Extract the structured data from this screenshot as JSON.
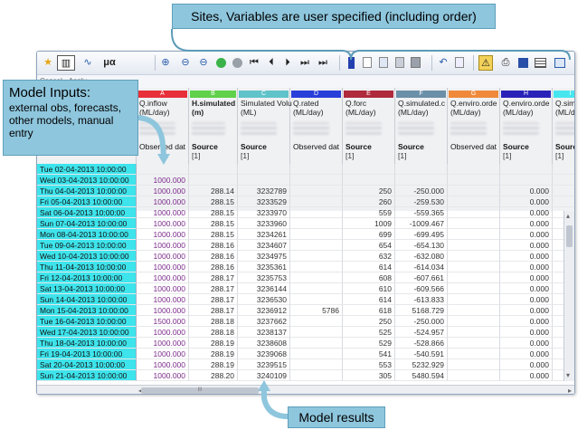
{
  "callouts": {
    "top": "Sites, Variables are user specified (including order)",
    "left_title": "Model Inputs:",
    "left_body": "external obs, forecasts, other models, manual entry",
    "bottom": "Model results"
  },
  "toolbar": {
    "sub_labels": [
      "Cancel",
      "Apply"
    ],
    "glyphs": {
      "star": "★",
      "table": "▥",
      "line": "∿",
      "mu": "μα",
      "zoom": "⊕",
      "zoomout": "⊖",
      "first": "⏮",
      "prev": "⏴",
      "next": "⏵",
      "last": "⏭",
      "undo": "↶",
      "warn": "⚠",
      "print": "⎙",
      "save": "💾"
    }
  },
  "columns": [
    {
      "letter": "A",
      "color": "#e8303a",
      "title": "Q.inflow\n(ML/day)",
      "bold": false,
      "source": "Observed dat",
      "source_sub": ""
    },
    {
      "letter": "B",
      "color": "#5fd14a",
      "title": "H.simulated\n(m)",
      "bold": true,
      "source": "Source",
      "source_sub": "[1]"
    },
    {
      "letter": "C",
      "color": "#5fc3c9",
      "title": "Simulated Volu\n(ML)",
      "bold": false,
      "source": "Source",
      "source_sub": "[1]"
    },
    {
      "letter": "D",
      "color": "#2a3fd9",
      "title": "Q.rated\n(ML/day)",
      "bold": false,
      "source": "Observed dat",
      "source_sub": ""
    },
    {
      "letter": "E",
      "color": "#b02a3d",
      "title": "Q.forc\n(ML/day)",
      "bold": false,
      "source": "Source",
      "source_sub": "[1]"
    },
    {
      "letter": "F",
      "color": "#6a8fa8",
      "title": "Q.simulated.c\n(ML/day)",
      "bold": false,
      "source": "Source",
      "source_sub": "[1]"
    },
    {
      "letter": "G",
      "color": "#f08a3a",
      "title": "Q.enviro.orde\n(ML/day)",
      "bold": false,
      "source": "Observed dat",
      "source_sub": ""
    },
    {
      "letter": "H",
      "color": "#2a22b8",
      "title": "Q.enviro.orde\n(ML/day)",
      "bold": false,
      "source": "Source",
      "source_sub": "[1]"
    },
    {
      "letter": "I",
      "color": "#47e6ee",
      "title": "Q.simulat\n(ML/day)",
      "bold": false,
      "source": "Source",
      "source_sub": "[1]"
    }
  ],
  "rows": [
    {
      "date": "Tue 02-04-2013 10:00:00",
      "v": [
        "",
        "",
        "",
        "",
        "",
        "",
        "",
        "",
        ""
      ]
    },
    {
      "date": "Wed 03-04-2013 10:00:00",
      "v": [
        "1000.000",
        "",
        "",
        "",
        "",
        "",
        "",
        "",
        ""
      ]
    },
    {
      "date": "Thu 04-04-2013 10:00:00",
      "v": [
        "1000.000",
        "288.14",
        "3232789",
        "",
        "250",
        "-250.000",
        "",
        "0.000",
        "25("
      ]
    },
    {
      "date": "Fri 05-04-2013 10:00:00",
      "v": [
        "1000.000",
        "288.15",
        "3233529",
        "",
        "260",
        "-259.530",
        "",
        "0.000",
        "25("
      ]
    },
    {
      "date": "Sat 06-04-2013 10:00:00",
      "v": [
        "1000.000",
        "288.15",
        "3233970",
        "",
        "559",
        "-559.365",
        "",
        "0.000",
        "25("
      ]
    },
    {
      "date": "Sun 07-04-2013 10:00:00",
      "v": [
        "1000.000",
        "288.15",
        "3233960",
        "",
        "1009",
        "-1009.467",
        "",
        "0.000",
        "25("
      ]
    },
    {
      "date": "Mon 08-04-2013 10:00:00",
      "v": [
        "1000.000",
        "288.15",
        "3234261",
        "",
        "699",
        "-699.495",
        "",
        "0.000",
        "25("
      ]
    },
    {
      "date": "Tue 09-04-2013 10:00:00",
      "v": [
        "1000.000",
        "288.16",
        "3234607",
        "",
        "654",
        "-654.130",
        "",
        "0.000",
        "25("
      ]
    },
    {
      "date": "Wed 10-04-2013 10:00:00",
      "v": [
        "1000.000",
        "288.16",
        "3234975",
        "",
        "632",
        "-632.080",
        "",
        "0.000",
        "25("
      ]
    },
    {
      "date": "Thu 11-04-2013 10:00:00",
      "v": [
        "1000.000",
        "288.16",
        "3235361",
        "",
        "614",
        "-614.034",
        "",
        "0.000",
        "25("
      ]
    },
    {
      "date": "Fri 12-04-2013 10:00:00",
      "v": [
        "1000.000",
        "288.17",
        "3235753",
        "",
        "608",
        "-607.661",
        "",
        "0.000",
        "25("
      ]
    },
    {
      "date": "Sat 13-04-2013 10:00:00",
      "v": [
        "1000.000",
        "288.17",
        "3236144",
        "",
        "610",
        "-609.566",
        "",
        "0.000",
        "25("
      ]
    },
    {
      "date": "Sun 14-04-2013 10:00:00",
      "v": [
        "1000.000",
        "288.17",
        "3236530",
        "",
        "614",
        "-613.833",
        "",
        "0.000",
        "25("
      ]
    },
    {
      "date": "Mon 15-04-2013 10:00:00",
      "v": [
        "1000.000",
        "288.17",
        "3236912",
        "5786",
        "618",
        "5168.729",
        "",
        "0.000",
        "25("
      ]
    },
    {
      "date": "Tue 16-04-2013 10:00:00",
      "v": [
        "1500.000",
        "288.18",
        "3237662",
        "",
        "250",
        "-250.000",
        "",
        "0.000",
        "25("
      ]
    },
    {
      "date": "Wed 17-04-2013 10:00:00",
      "v": [
        "1000.000",
        "288.18",
        "3238137",
        "",
        "525",
        "-524.957",
        "",
        "0.000",
        "25("
      ]
    },
    {
      "date": "Thu 18-04-2013 10:00:00",
      "v": [
        "1000.000",
        "288.19",
        "3238608",
        "",
        "529",
        "-528.866",
        "",
        "0.000",
        "25("
      ]
    },
    {
      "date": "Fri 19-04-2013 10:00:00",
      "v": [
        "1000.000",
        "288.19",
        "3239068",
        "",
        "541",
        "-540.591",
        "",
        "0.000",
        "25("
      ]
    },
    {
      "date": "Sat 20-04-2013 10:00:00",
      "v": [
        "1000.000",
        "288.19",
        "3239515",
        "",
        "553",
        "5232.929",
        "",
        "0.000",
        "25("
      ]
    },
    {
      "date": "Sun 21-04-2013 10:00:00",
      "v": [
        "1000.000",
        "288.20",
        "3240109",
        "",
        "305",
        "5480.594",
        "",
        "0.000",
        "25("
      ]
    }
  ],
  "scroll": {
    "left_arrow": "◂",
    "right_arrow": "▸",
    "up_arrow": "▴",
    "down_arrow": "▾",
    "grip": "III"
  }
}
